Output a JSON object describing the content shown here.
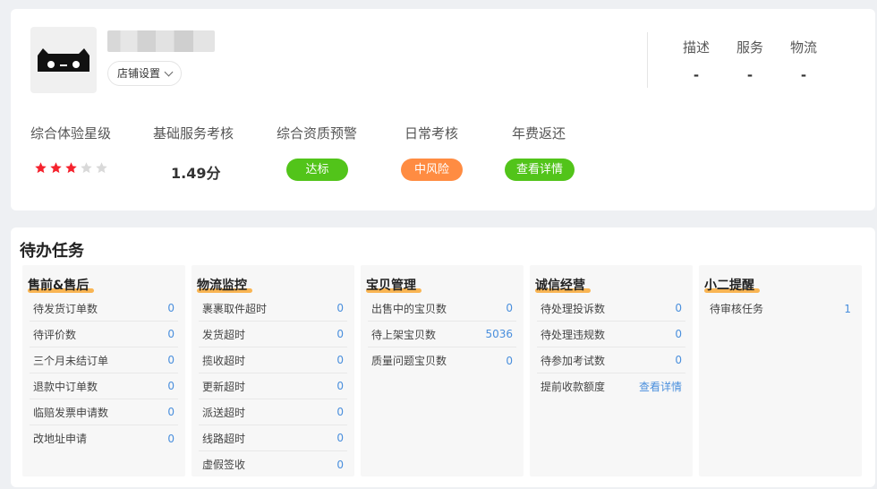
{
  "shop": {
    "settings_label": "店铺设置"
  },
  "scores": [
    {
      "label": "描述",
      "value": "-"
    },
    {
      "label": "服务",
      "value": "-"
    },
    {
      "label": "物流",
      "value": "-"
    }
  ],
  "metrics": {
    "experience": {
      "label": "综合体验星级",
      "stars_filled": 3,
      "stars_total": 5
    },
    "service": {
      "label": "基础服务考核",
      "value": "1.49分"
    },
    "qualification": {
      "label": "综合资质预警",
      "badge": "达标",
      "badge_color": "#52c41a"
    },
    "daily": {
      "label": "日常考核",
      "badge": "中风险",
      "badge_color": "#ff8c42"
    },
    "annual_fee": {
      "label": "年费返还",
      "badge": "查看详情",
      "badge_color": "#52c41a"
    }
  },
  "colors": {
    "star_filled": "#f5222d",
    "star_empty": "#d9d9d9",
    "link": "#4a8fdd",
    "title_underline": "#f9b14a"
  },
  "todo": {
    "title": "待办任务",
    "panels": [
      {
        "title": "售前&售后",
        "rows": [
          {
            "label": "待发货订单数",
            "value": "0"
          },
          {
            "label": "待评价数",
            "value": "0"
          },
          {
            "label": "三个月未结订单",
            "value": "0"
          },
          {
            "label": "退款中订单数",
            "value": "0"
          },
          {
            "label": "临赔发票申请数",
            "value": "0"
          },
          {
            "label": "改地址申请",
            "value": "0"
          }
        ]
      },
      {
        "title": "物流监控",
        "rows": [
          {
            "label": "裹裹取件超时",
            "value": "0"
          },
          {
            "label": "发货超时",
            "value": "0"
          },
          {
            "label": "揽收超时",
            "value": "0"
          },
          {
            "label": "更新超时",
            "value": "0"
          },
          {
            "label": "派送超时",
            "value": "0"
          },
          {
            "label": "线路超时",
            "value": "0"
          },
          {
            "label": "虚假签收",
            "value": "0"
          }
        ]
      },
      {
        "title": "宝贝管理",
        "rows": [
          {
            "label": "出售中的宝贝数",
            "value": "0"
          },
          {
            "label": "待上架宝贝数",
            "value": "5036"
          },
          {
            "label": "质量问题宝贝数",
            "value": "0"
          }
        ]
      },
      {
        "title": "诚信经营",
        "rows": [
          {
            "label": "待处理投诉数",
            "value": "0"
          },
          {
            "label": "待处理违规数",
            "value": "0"
          },
          {
            "label": "待参加考试数",
            "value": "0"
          },
          {
            "label": "提前收款额度",
            "value": "查看详情"
          }
        ]
      },
      {
        "title": "小二提醒",
        "rows": [
          {
            "label": "待审核任务",
            "value": "1"
          }
        ]
      }
    ]
  }
}
